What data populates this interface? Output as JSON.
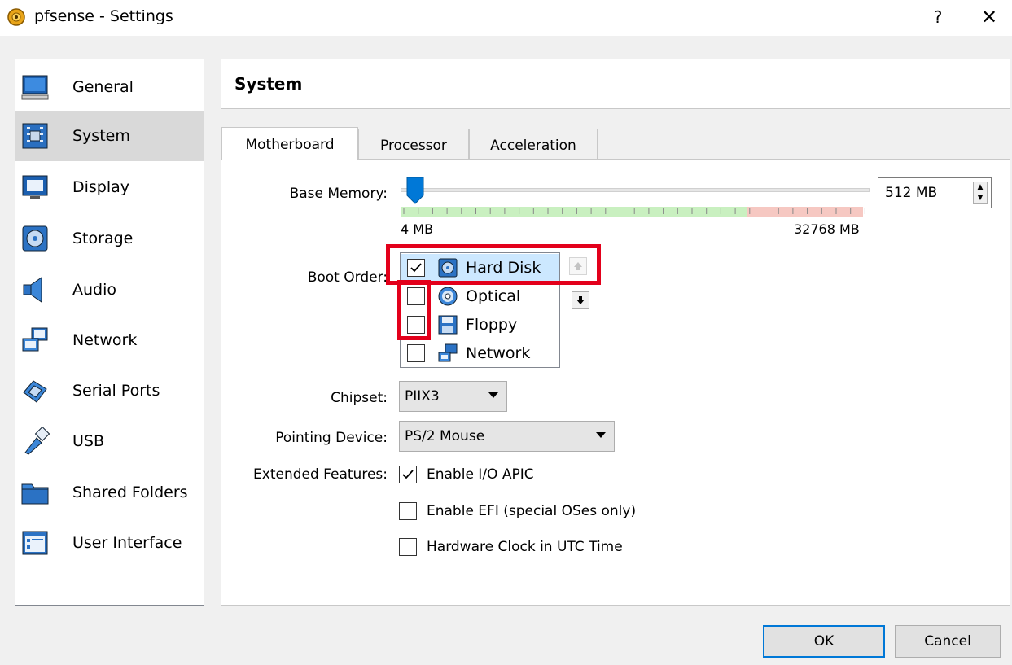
{
  "window": {
    "title": "pfsense - Settings",
    "help": "?",
    "close": "✕"
  },
  "sidebar": {
    "items": [
      {
        "label": "General",
        "icon": "general-icon"
      },
      {
        "label": "System",
        "icon": "system-icon",
        "selected": true
      },
      {
        "label": "Display",
        "icon": "display-icon"
      },
      {
        "label": "Storage",
        "icon": "storage-icon"
      },
      {
        "label": "Audio",
        "icon": "audio-icon"
      },
      {
        "label": "Network",
        "icon": "network-icon"
      },
      {
        "label": "Serial Ports",
        "icon": "serial-ports-icon"
      },
      {
        "label": "USB",
        "icon": "usb-icon"
      },
      {
        "label": "Shared Folders",
        "icon": "shared-folders-icon"
      },
      {
        "label": "User Interface",
        "icon": "user-interface-icon"
      }
    ]
  },
  "page": {
    "title": "System"
  },
  "tabs": [
    {
      "label": "Motherboard",
      "active": true
    },
    {
      "label": "Processor"
    },
    {
      "label": "Acceleration"
    }
  ],
  "motherboard": {
    "base_memory_label": "Base Memory:",
    "memory_min": "4 MB",
    "memory_max": "32768 MB",
    "memory_value": "512 MB",
    "memory_fraction": 0.016,
    "boot_order_label": "Boot Order:",
    "boot_items": [
      {
        "label": "Hard Disk",
        "checked": true,
        "icon": "hard-disk-icon"
      },
      {
        "label": "Optical",
        "checked": false,
        "icon": "optical-disc-icon"
      },
      {
        "label": "Floppy",
        "checked": false,
        "icon": "floppy-icon"
      },
      {
        "label": "Network",
        "checked": false,
        "icon": "network-icon"
      }
    ],
    "chipset_label": "Chipset:",
    "chipset_value": "PIIX3",
    "pointing_label": "Pointing Device:",
    "pointing_value": "PS/2 Mouse",
    "extended_label": "Extended Features:",
    "features": [
      {
        "label": "Enable I/O APIC",
        "checked": true
      },
      {
        "label": "Enable EFI (special OSes only)",
        "checked": false
      },
      {
        "label": "Hardware Clock in UTC Time",
        "checked": false
      }
    ]
  },
  "buttons": {
    "ok": "OK",
    "cancel": "Cancel"
  },
  "colors": {
    "highlight": "#e3001b",
    "selection": "#cce8ff",
    "accent": "#0078d7"
  }
}
